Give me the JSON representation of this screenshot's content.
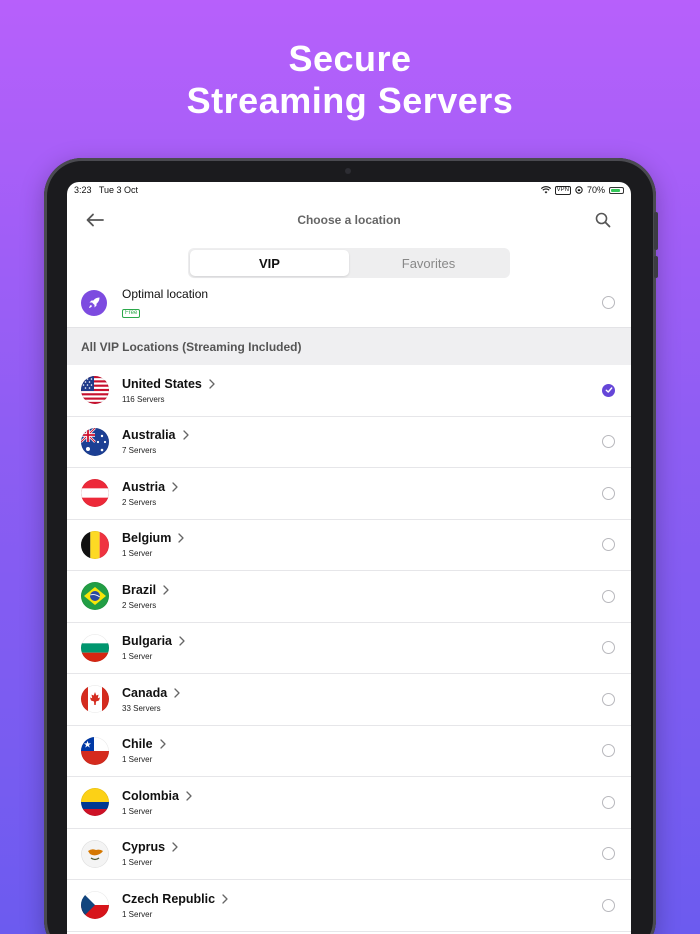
{
  "headline": {
    "line1": "Secure",
    "line2": "Streaming Servers"
  },
  "status": {
    "time": "3:23",
    "date": "Tue 3 Oct",
    "vpn": "VPN",
    "battery": "70%"
  },
  "nav": {
    "title": "Choose a location"
  },
  "tabs": [
    {
      "label": "VIP"
    },
    {
      "label": "Favorites"
    }
  ],
  "optimal": {
    "label": "Optimal location",
    "badge": "Free"
  },
  "section": {
    "title": "All VIP Locations (Streaming Included)"
  },
  "countries": [
    {
      "name": "United States",
      "servers": "116 Servers",
      "selected": true,
      "flag": "us"
    },
    {
      "name": "Australia",
      "servers": "7 Servers",
      "selected": false,
      "flag": "au"
    },
    {
      "name": "Austria",
      "servers": "2 Servers",
      "selected": false,
      "flag": "at"
    },
    {
      "name": "Belgium",
      "servers": "1 Server",
      "selected": false,
      "flag": "be"
    },
    {
      "name": "Brazil",
      "servers": "2 Servers",
      "selected": false,
      "flag": "br"
    },
    {
      "name": "Bulgaria",
      "servers": "1 Server",
      "selected": false,
      "flag": "bg"
    },
    {
      "name": "Canada",
      "servers": "33 Servers",
      "selected": false,
      "flag": "ca"
    },
    {
      "name": "Chile",
      "servers": "1 Server",
      "selected": false,
      "flag": "cl"
    },
    {
      "name": "Colombia",
      "servers": "1 Server",
      "selected": false,
      "flag": "co"
    },
    {
      "name": "Cyprus",
      "servers": "1 Server",
      "selected": false,
      "flag": "cy"
    },
    {
      "name": "Czech Republic",
      "servers": "1 Server",
      "selected": false,
      "flag": "cz"
    }
  ],
  "colors": {
    "accent": "#6546d8",
    "rocket": "#7d4be0",
    "free": "#2ba84a"
  }
}
